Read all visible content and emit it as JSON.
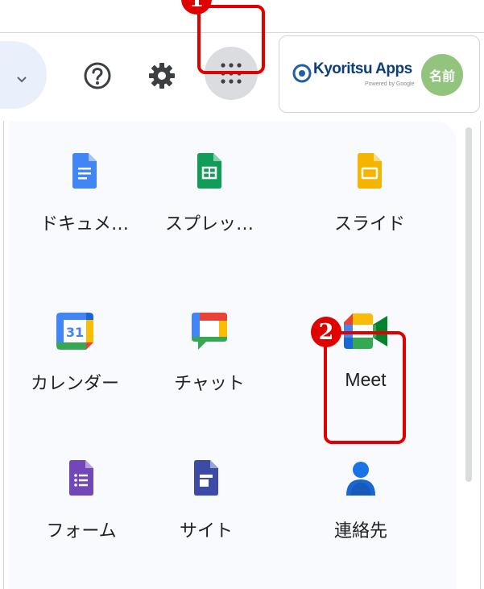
{
  "header": {
    "brand": {
      "name": "Kyoritsu Apps",
      "powered_by": "Powered by Google"
    },
    "avatar_text": "名前"
  },
  "markers": {
    "first": "1",
    "second": "2"
  },
  "apps": [
    {
      "label": "ドキュメ…",
      "icon": "google-docs-icon"
    },
    {
      "label": "スプレッ…",
      "icon": "google-sheets-icon"
    },
    {
      "label": "スライド",
      "icon": "google-slides-icon"
    },
    {
      "label": "カレンダー",
      "icon": "google-calendar-icon",
      "calendar_day": "31"
    },
    {
      "label": "チャット",
      "icon": "google-chat-icon"
    },
    {
      "label": "Meet",
      "icon": "google-meet-icon"
    },
    {
      "label": "フォーム",
      "icon": "google-forms-icon"
    },
    {
      "label": "サイト",
      "icon": "google-sites-icon"
    },
    {
      "label": "連絡先",
      "icon": "google-contacts-icon"
    }
  ],
  "colors": {
    "highlight": "#e00000",
    "docs": "#4285f4",
    "sheets": "#0f9d58",
    "slides": "#f4b400",
    "forms": "#7248b9",
    "sites": "#3c4ba6",
    "avatar": "#93c47d"
  }
}
